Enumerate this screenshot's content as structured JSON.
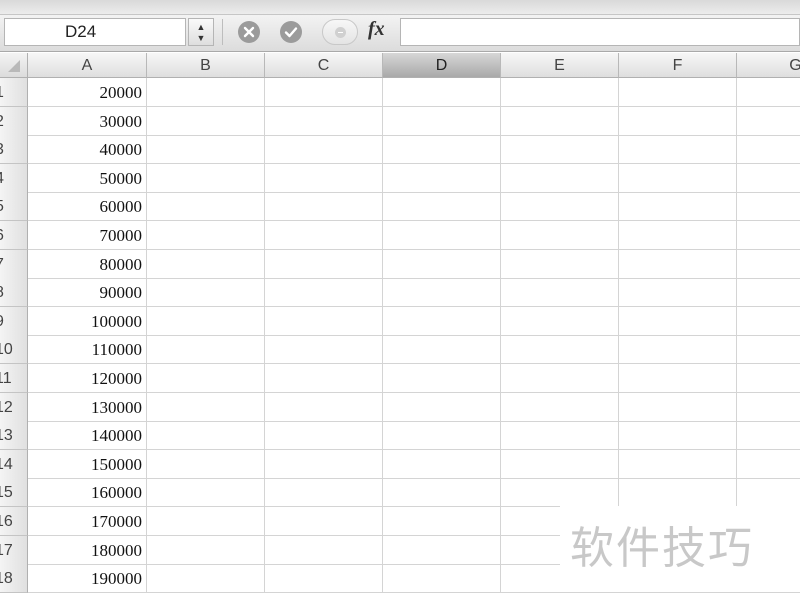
{
  "formula_bar": {
    "name_box": "D24",
    "stepper": "▲▼",
    "fx": "fx",
    "formula": ""
  },
  "columns": [
    "A",
    "B",
    "C",
    "D",
    "E",
    "F",
    "G"
  ],
  "selected_column": "D",
  "rows": [
    {
      "num": "1",
      "a": "20000"
    },
    {
      "num": "2",
      "a": "30000"
    },
    {
      "num": "3",
      "a": "40000"
    },
    {
      "num": "4",
      "a": "50000"
    },
    {
      "num": "5",
      "a": "60000"
    },
    {
      "num": "6",
      "a": "70000"
    },
    {
      "num": "7",
      "a": "80000"
    },
    {
      "num": "8",
      "a": "90000"
    },
    {
      "num": "9",
      "a": "100000"
    },
    {
      "num": "10",
      "a": "110000"
    },
    {
      "num": "11",
      "a": "120000"
    },
    {
      "num": "12",
      "a": "130000"
    },
    {
      "num": "13",
      "a": "140000"
    },
    {
      "num": "14",
      "a": "150000"
    },
    {
      "num": "15",
      "a": "160000"
    },
    {
      "num": "16",
      "a": "170000"
    },
    {
      "num": "17",
      "a": "180000"
    },
    {
      "num": "18",
      "a": "190000"
    }
  ],
  "watermark": "软件技巧"
}
